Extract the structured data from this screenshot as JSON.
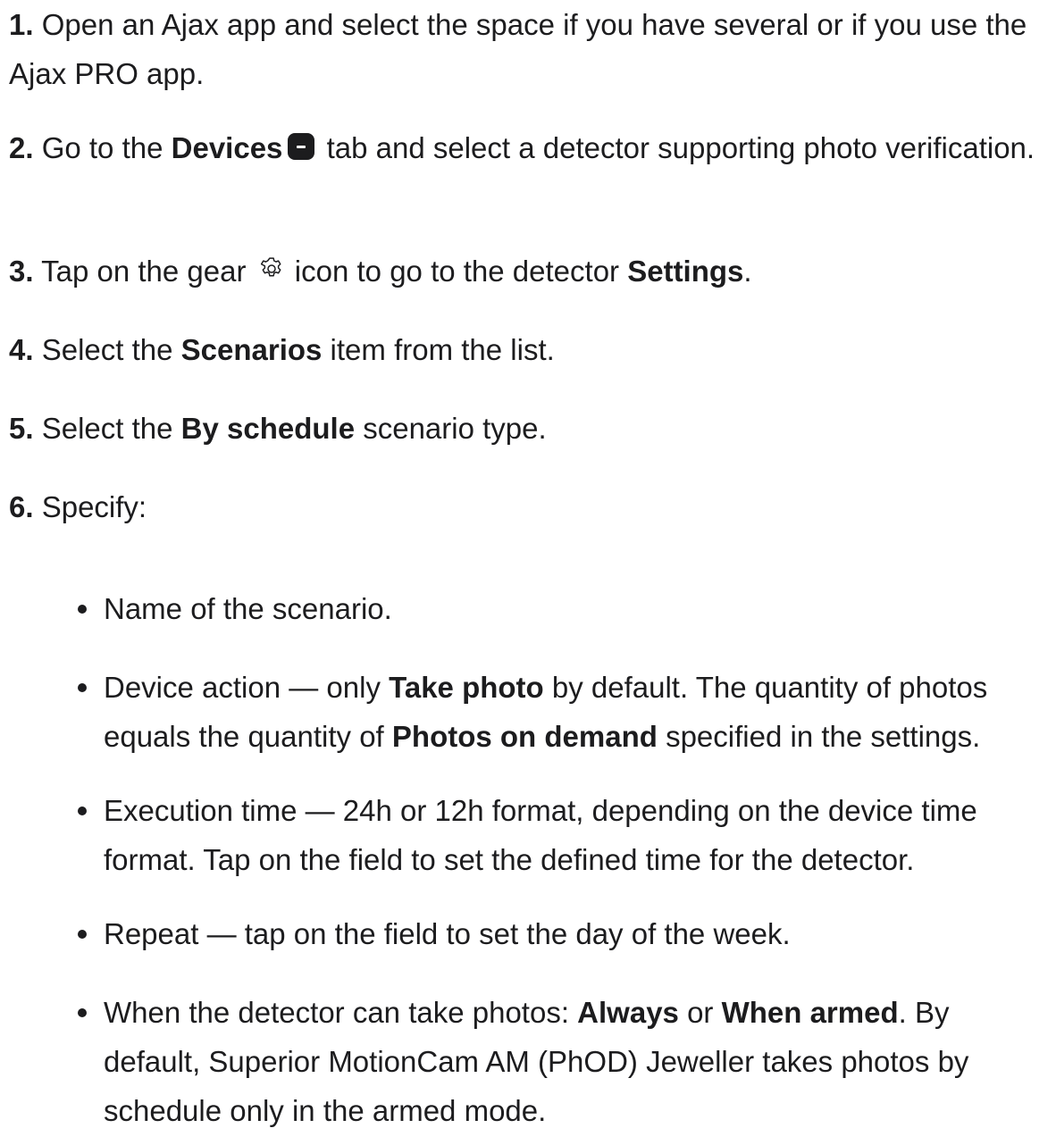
{
  "steps": [
    {
      "num": "1.",
      "text": "Open an Ajax app and select the space if you have several or if you use the Ajax PRO app."
    },
    {
      "num": "2.",
      "pre": "Go to the ",
      "bold": "Devices",
      "icon": "devices-icon",
      "post": " tab and select a detector supporting photo verification."
    },
    {
      "num": "3.",
      "pre": "Tap on the gear ",
      "icon": "gear-icon",
      "mid": " icon to go to the detector ",
      "bold": "Settings",
      "post": "."
    },
    {
      "num": "4.",
      "pre": "Select the ",
      "bold": "Scenarios",
      "post": " item from the list."
    },
    {
      "num": "5.",
      "pre": "Select the ",
      "bold": "By schedule",
      "post": " scenario type."
    },
    {
      "num": "6.",
      "text": "Specify:"
    }
  ],
  "bullets": [
    {
      "text": "Name of the scenario."
    },
    {
      "pre": "Device action — only ",
      "bold1": "Take photo",
      "mid": " by default. The quantity of photos equals the quantity of ",
      "bold2": "Photos on demand",
      "post": " specified in the settings."
    },
    {
      "text": "Execution time — 24h or 12h format, depending on the device time format. Tap on the field to set the defined time for the detector."
    },
    {
      "text": "Repeat — tap on the field to set the day of the week."
    },
    {
      "pre": "When the detector can take photos: ",
      "bold1": "Always",
      "mid": " or ",
      "bold2": "When armed",
      "post": ". By default, Superior MotionCam AM (PhOD) Jeweller takes photos by schedule only in the armed mode."
    }
  ]
}
